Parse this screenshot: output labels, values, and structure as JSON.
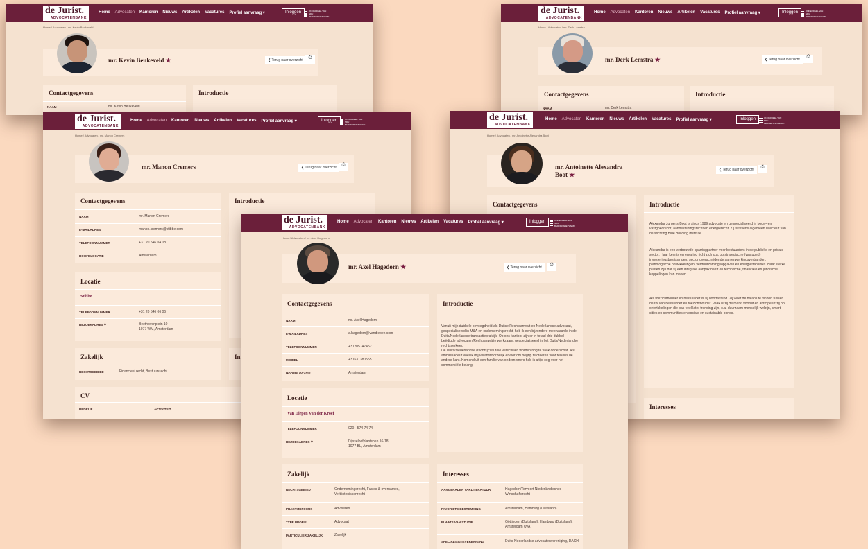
{
  "nav": {
    "logo_main": "de Jurist.",
    "logo_sub": "ADVOCATENBANK",
    "menu": [
      "Home",
      "Advocaten",
      "Kantoren",
      "Nieuws",
      "Artikelen",
      "Vacatures",
      "Profiel aanvraag ▾"
    ],
    "login": "Inloggen",
    "partner": "ONDERDEEL VAN SDU BEROEPSNETWERK"
  },
  "common": {
    "back": "❮ Terug naar overzicht",
    "print_icon": "⎙",
    "contact_title": "Contactgegevens",
    "intro_title": "Introductie",
    "locatie_title": "Locatie",
    "zakelijk_title": "Zakelijk",
    "interesses_title": "Interesses",
    "cv_title": "CV"
  },
  "kevin": {
    "crumb": "Home / Advocaten / mr. Kevin Beukeveld",
    "name": "mr. Kevin Beukeveld",
    "star": "★",
    "naam_label": "NAAM",
    "naam": "mr. Kevin Beukeveld"
  },
  "derk": {
    "crumb": "Home / Advocaten / mr. Derk Lemstra",
    "name": "mr. Derk Lemstra",
    "star": "★",
    "naam_label": "NAAM",
    "naam": "mr. Derk Lemstra"
  },
  "manon": {
    "crumb": "Home / Advocaten / mr. Manon Cremers",
    "name": "mr. Manon Cremers",
    "contact": [
      {
        "label": "NAAM",
        "value": "mr. Manon Cremers"
      },
      {
        "label": "E-MAILADRES",
        "value": "manon.cremers@stibbe.com"
      },
      {
        "label": "TELEFOONNUMMER",
        "value": "+31 20 546 04 08"
      },
      {
        "label": "HOOFDLOCATIE",
        "value": "Amsterdam"
      }
    ],
    "location_name": "Stibbe",
    "location": [
      {
        "label": "TELEFOONNUMMER",
        "value": "+31 20 546 06 06"
      },
      {
        "label": "BEZOEKADRES ⚲",
        "value": "Beethovenplein 10\n1077 WM, Amsterdam"
      }
    ],
    "zakelijk": [
      {
        "label": "RECHTSGEBIED",
        "value": "Financieel recht, Bestuursrecht"
      }
    ],
    "intro_cut": "Int",
    "cv_cols": [
      "BEDRIJF",
      "ACTIVITEIT"
    ]
  },
  "antoinette": {
    "crumb": "Home / Advocaten / mr. Antoinette Alexandra Boot",
    "name_line1": "mr. Antoinette Alexandra",
    "name_line2": "Boot",
    "star": "★",
    "intro": [
      "Alexandra Jurgens-Boot is sinds 1989 advocate en gespecialiseerd in bouw- en vastgoedrecht, aanbestedingsrecht en energierecht. Zij is tevens algemeen directeur van de stichting Blue Building Institute.",
      "Alexandra is een vertrouwde sparringpartner voor bestuurders in de publieke en private sector. Haar kennis en ervaring richt zich o.a. op strategische (vastgoed) investeringsbeslissingen, sector overschrijdende samenwerkingsverbanden, planologische ontwikkelingen, verduurzamingsopgaven en energietransities. Haar sterke punten zijn dat zij een integrale aanpak heeft en technische, financiële en juridische koppelingen kan maken.",
      "Als toezichthouder en bestuurder is zij doortastend. Zij weet de balans te vinden tussen de rol van bestuurder en toezichthouder. Vaak is zij de markt vooruit en anticipeert zij op ontwikkelingen die pas veel later trending zijn, o.a. duurzaam menselijk welzijn, smart cities en communities en sociale en sustainable bonds."
    ]
  },
  "axel": {
    "crumb": "Home / Advocaten / mr. Axel Hagedorn",
    "name": "mr. Axel Hagedorn",
    "star": "★",
    "contact": [
      {
        "label": "NAAM",
        "value": "mr. Axel Hagedorn"
      },
      {
        "label": "E-MAILADRES",
        "value": "a.hagedorn@vandiepen.com"
      },
      {
        "label": "TELEFOONNUMMER",
        "value": "+31205747452"
      },
      {
        "label": "MOBIEL",
        "value": "+31631380555"
      },
      {
        "label": "HOOFDLOCATIE",
        "value": "Amsterdam"
      }
    ],
    "intro": "Vanuit mijn dubbele bevoegdheid als Duitse Rechtsanwalt en Nederlandse advocaat, gespecialiseerd in M&A en ondernemingsrecht, heb ik een bijzondere meerwaarde in de Duits/Nederlandse transactiepraktijk. Op ons kantoor zijn er in totaal drie dubbel beëdigde advocaten/Rechtsanwälte werkzaam, gespecialiseerd in het Duits/Nederlandse rechtsverkeer.\nDe Duits/Nederlandse (rechts)culturele verschillen worden nog te vaak onderschat. Als ambassadeur voel ik mij verantwoordelijk ervoor om begrip te creëren voor telkens de andere kant. Komend uit een familie van ondernemers heb ik altijd oog voor het commerciële belang.",
    "location_name": "Van Diepen Van der Kroef",
    "location": [
      {
        "label": "TELEFOONNUMMER",
        "value": "020 - 574 74 74"
      },
      {
        "label": "BEZOEKADRES ⚲",
        "value": "Dijsselhofplantsoen 16-18\n1077 BL, Amsterdam"
      }
    ],
    "zakelijk": [
      {
        "label": "RECHTSGEBIED",
        "value": "Ondernemingsrecht, Fusies & overnames, Verbintenissenrecht"
      },
      {
        "label": "PRAKTIJKFOCUS",
        "value": "Adviseren"
      },
      {
        "label": "TYPE PROFIEL",
        "value": "Advocaat"
      },
      {
        "label": "PARTICULIER/ZAKELIJK",
        "value": "Zakelijk"
      }
    ],
    "interesses": [
      {
        "label": "AANGERADEN VAKLITERATUUR",
        "value": "Hagedorn/Tervoort Niederländisches Wirtschaftsrecht"
      },
      {
        "label": "FAVORIETE BESTEMMING",
        "value": "Amsterdam, Hamburg (Duitsland)"
      },
      {
        "label": "PLAATS VAN STUDIE",
        "value": "Göttingen (Duitsland), Hamburg (Duitsland), Amsterdam UvA"
      },
      {
        "label": "SPECIALISATIEVERENIGING",
        "value": "Duits-Nederlandse advocatenvereniging, DACH"
      }
    ]
  }
}
